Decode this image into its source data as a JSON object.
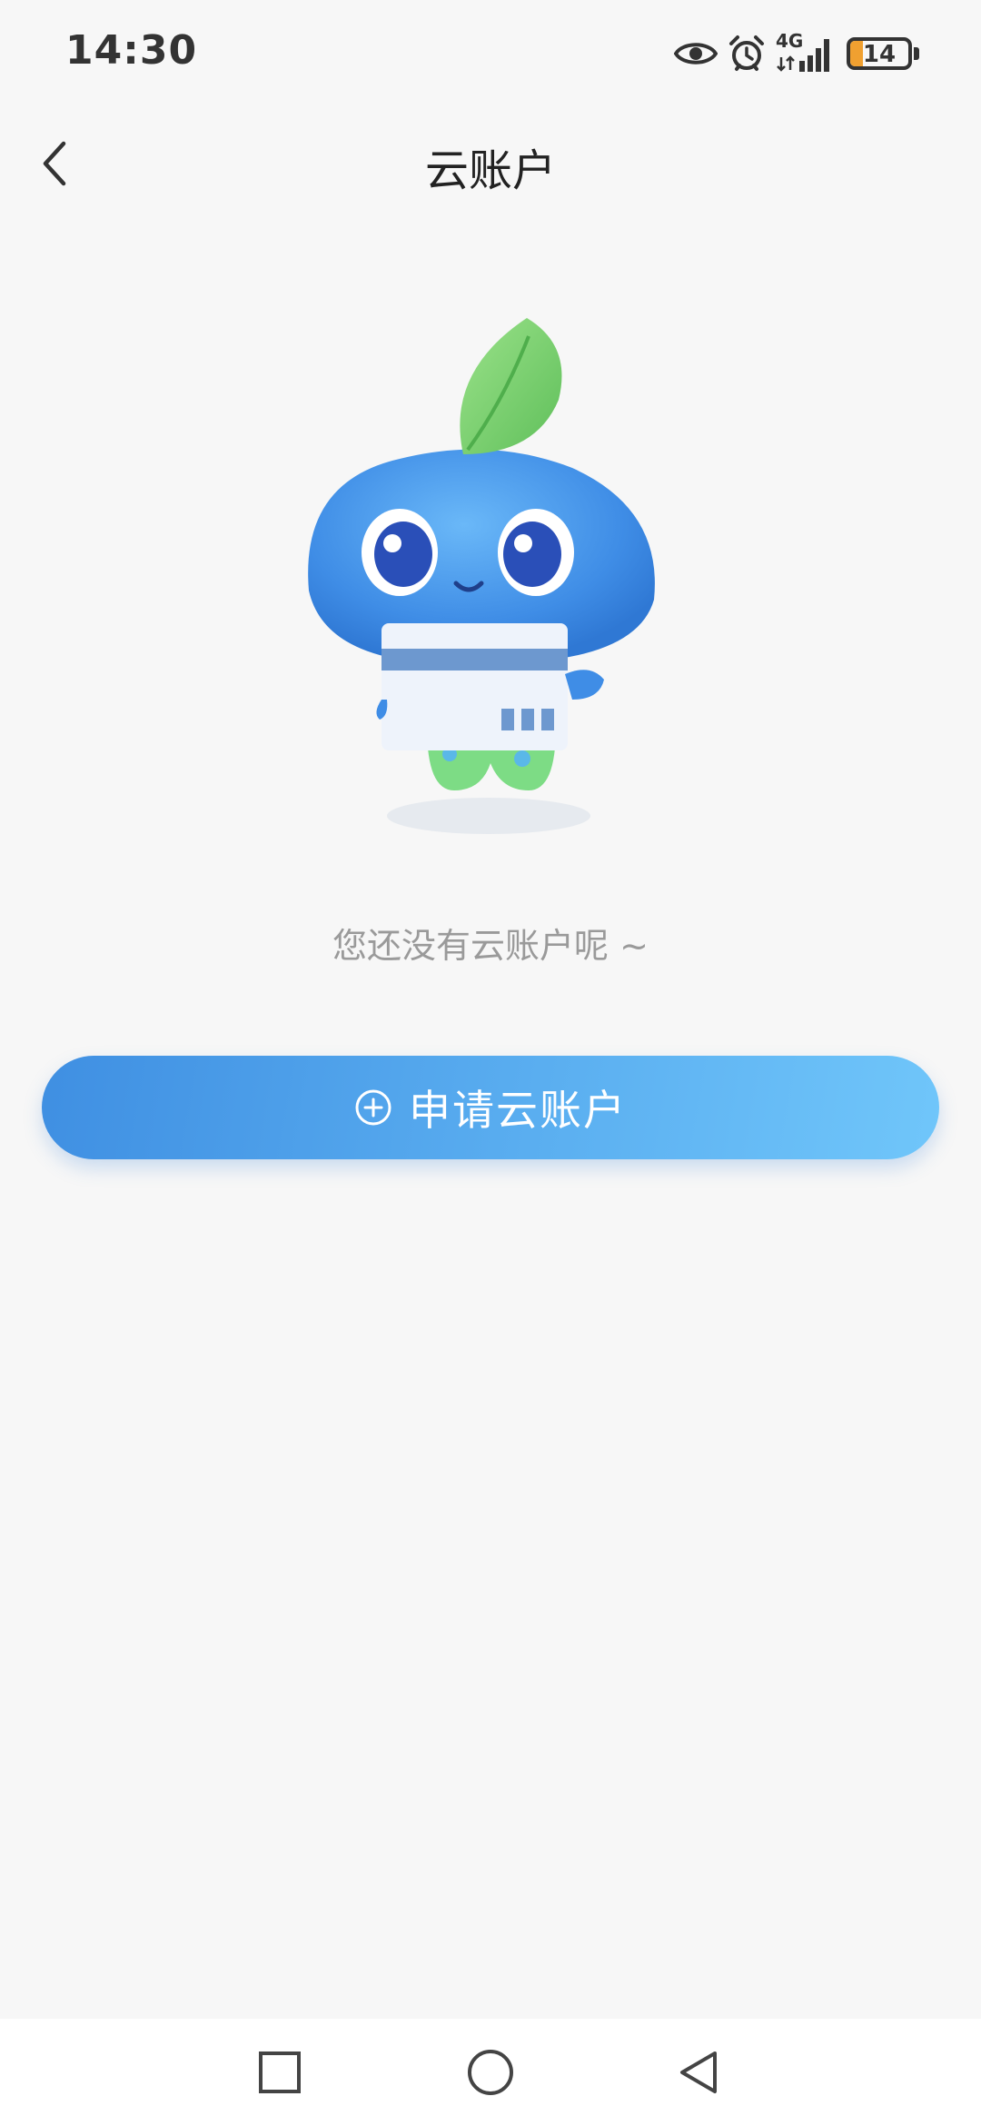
{
  "status_bar": {
    "time": "14:30",
    "network_type": "4G",
    "battery_level": "14",
    "icons": [
      "eye-icon",
      "alarm-icon",
      "signal-icon",
      "battery-icon"
    ],
    "battery_color": "#f0a030"
  },
  "nav": {
    "title": "云账户",
    "back_icon": "chevron-left-icon"
  },
  "empty_state": {
    "illustration": "blue-mascot-holding-card",
    "message": "您还没有云账户呢 ~"
  },
  "apply_button": {
    "label": "申请云账户",
    "icon": "plus-circle-icon",
    "colors": [
      "#3f8fe2",
      "#70c6fa"
    ]
  },
  "system_nav": {
    "buttons": [
      "recent-apps-icon",
      "home-icon",
      "back-triangle-icon"
    ]
  }
}
